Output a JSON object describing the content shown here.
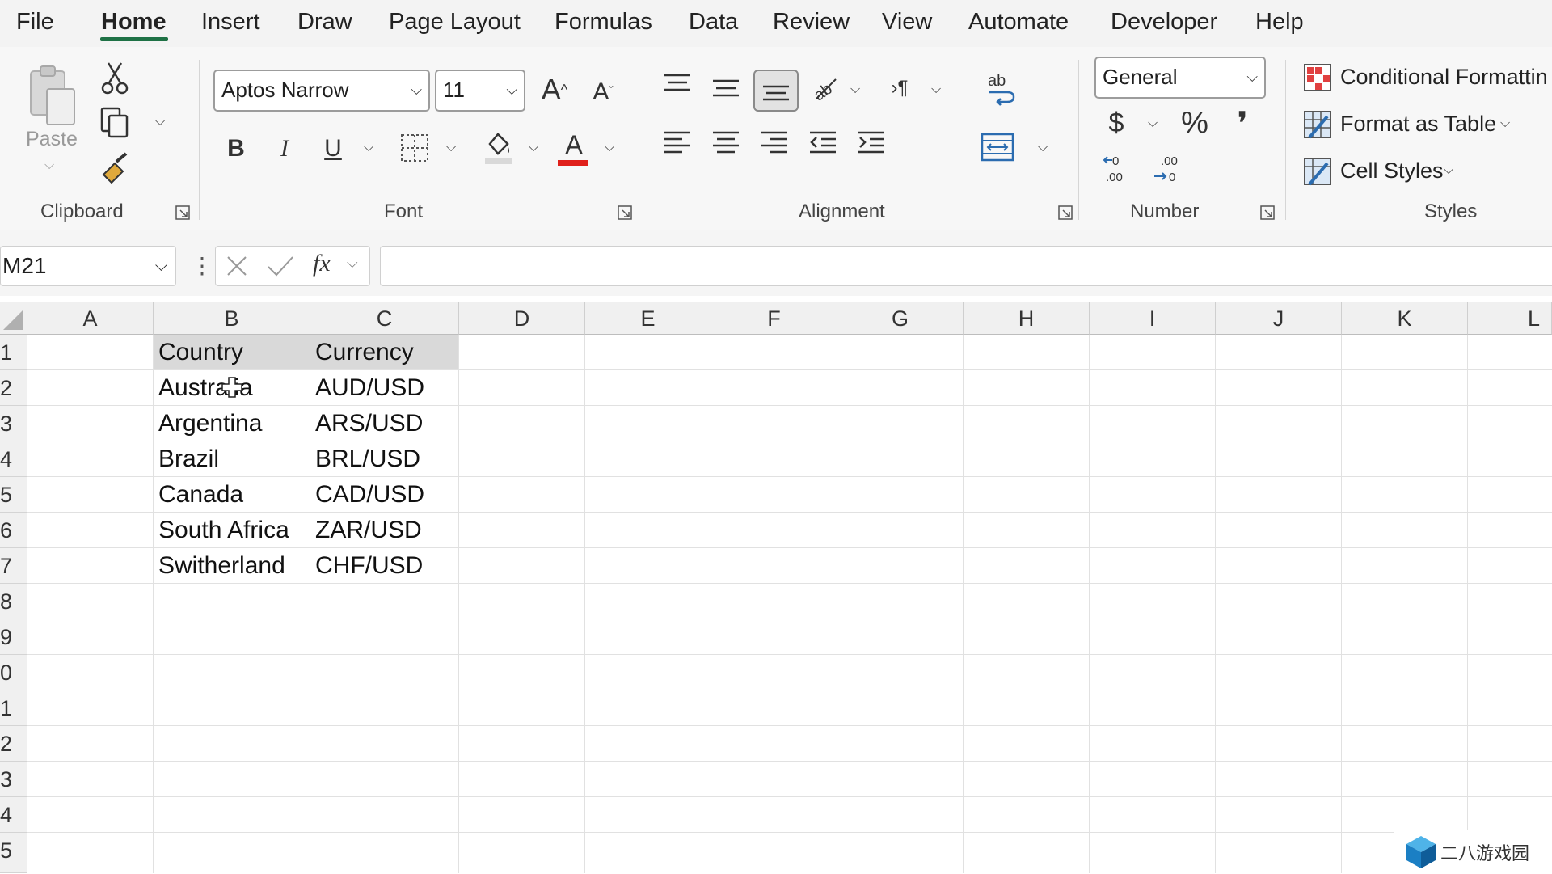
{
  "menu": {
    "tabs": [
      "File",
      "Home",
      "Insert",
      "Draw",
      "Page Layout",
      "Formulas",
      "Data",
      "Review",
      "View",
      "Automate",
      "Developer",
      "Help"
    ],
    "active": "Home"
  },
  "ribbon": {
    "clipboard": {
      "paste_label": "Paste",
      "group_label": "Clipboard"
    },
    "font": {
      "font_name": "Aptos Narrow",
      "font_size": "11",
      "bold": "B",
      "italic": "I",
      "underline": "U",
      "font_color_glyph": "A",
      "group_label": "Font",
      "font_color": "#e0201b"
    },
    "alignment": {
      "group_label": "Alignment"
    },
    "number": {
      "format": "General",
      "currency": "$",
      "percent": "%",
      "comma": "❜",
      "group_label": "Number"
    },
    "styles": {
      "conditional_formatting": "Conditional Formattin",
      "format_as_table": "Format as Table",
      "cell_styles": "Cell Styles",
      "group_label": "Styles"
    }
  },
  "formula_bar": {
    "name_box": "M21",
    "fx": "fx",
    "formula": ""
  },
  "sheet": {
    "columns": [
      "A",
      "B",
      "C",
      "D",
      "E",
      "F",
      "G",
      "H",
      "I",
      "J",
      "K",
      "L"
    ],
    "row_numbers": [
      "1",
      "2",
      "3",
      "4",
      "5",
      "6",
      "7",
      "8",
      "9",
      "0",
      "1",
      "2",
      "3",
      "4",
      "5"
    ],
    "header_row": [
      "Country",
      "Currency"
    ],
    "rows": [
      [
        "Australia",
        "AUD/USD"
      ],
      [
        "Argentina",
        "ARS/USD"
      ],
      [
        "Brazil",
        "BRL/USD"
      ],
      [
        "Canada",
        "CAD/USD"
      ],
      [
        "South Africa",
        "ZAR/USD"
      ],
      [
        "Switherland",
        "CHF/USD"
      ]
    ],
    "header_fill": "#d9d9d9"
  },
  "watermark": {
    "text": "二八游戏园",
    "logo": "cube-logo-icon"
  }
}
